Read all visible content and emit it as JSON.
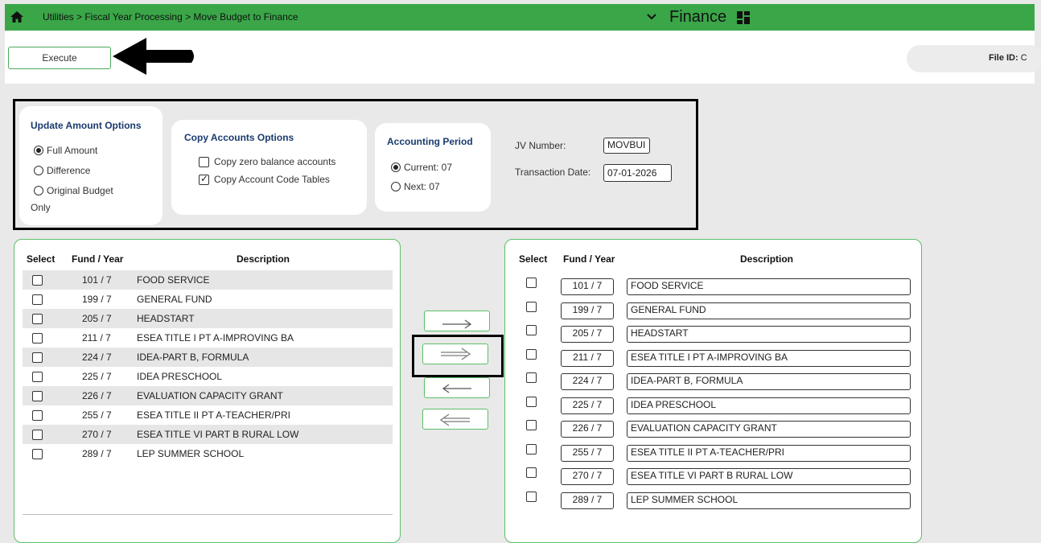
{
  "header": {
    "breadcrumb": "Utilities > Fiscal Year Processing > Move Budget to Finance",
    "app_title": "Finance",
    "bar_color": "#3aa648"
  },
  "toolbar": {
    "execute_label": "Execute",
    "file_id_label": "File ID:",
    "file_id_value": "C"
  },
  "update_amount": {
    "title": "Update Amount Options",
    "options": [
      {
        "label": "Full Amount",
        "selected": true
      },
      {
        "label": "Difference",
        "selected": false
      },
      {
        "label": "Original Budget",
        "selected": false
      }
    ],
    "wrap_text": "Only"
  },
  "copy_accounts": {
    "title": "Copy Accounts Options",
    "options": [
      {
        "label": "Copy zero balance accounts",
        "checked": false
      },
      {
        "label": "Copy Account Code Tables",
        "checked": true
      }
    ]
  },
  "accounting_period": {
    "title": "Accounting Period",
    "options": [
      {
        "label": "Current: 07",
        "selected": true
      },
      {
        "label": "Next: 07",
        "selected": false
      }
    ]
  },
  "jv": {
    "jv_label": "JV Number:",
    "jv_value": "MOVBUI",
    "date_label": "Transaction Date:",
    "date_value": "07-01-2026"
  },
  "left_table": {
    "headers": [
      "Select",
      "Fund / Year",
      "Description"
    ],
    "rows": [
      {
        "fund": "101 / 7",
        "desc": "FOOD SERVICE"
      },
      {
        "fund": "199 / 7",
        "desc": "GENERAL FUND"
      },
      {
        "fund": "205 / 7",
        "desc": "HEADSTART"
      },
      {
        "fund": "211 / 7",
        "desc": "ESEA TITLE I PT A-IMPROVING BA"
      },
      {
        "fund": "224 / 7",
        "desc": "IDEA-PART B, FORMULA"
      },
      {
        "fund": "225 / 7",
        "desc": "IDEA PRESCHOOL"
      },
      {
        "fund": "226 / 7",
        "desc": "EVALUATION CAPACITY GRANT"
      },
      {
        "fund": "255 / 7",
        "desc": "ESEA TITLE II PT A-TEACHER/PRI"
      },
      {
        "fund": "270 / 7",
        "desc": "ESEA TITLE VI PART B RURAL LOW"
      },
      {
        "fund": "289 / 7",
        "desc": "LEP SUMMER SCHOOL"
      }
    ]
  },
  "right_table": {
    "headers": [
      "Select",
      "Fund / Year",
      "Description"
    ],
    "rows": [
      {
        "fund": "101 / 7",
        "desc": "FOOD SERVICE"
      },
      {
        "fund": "199 / 7",
        "desc": "GENERAL FUND"
      },
      {
        "fund": "205 / 7",
        "desc": "HEADSTART"
      },
      {
        "fund": "211 / 7",
        "desc": "ESEA TITLE I PT A-IMPROVING BA"
      },
      {
        "fund": "224 / 7",
        "desc": "IDEA-PART B, FORMULA"
      },
      {
        "fund": "225 / 7",
        "desc": "IDEA PRESCHOOL"
      },
      {
        "fund": "226 / 7",
        "desc": "EVALUATION CAPACITY GRANT"
      },
      {
        "fund": "255 / 7",
        "desc": "ESEA TITLE II PT A-TEACHER/PRI"
      },
      {
        "fund": "270 / 7",
        "desc": "ESEA TITLE VI PART B RURAL LOW"
      },
      {
        "fund": "289 / 7",
        "desc": "LEP SUMMER SCHOOL"
      }
    ]
  },
  "move_buttons": [
    {
      "icon": "arrow-right-icon"
    },
    {
      "icon": "double-arrow-right-icon"
    },
    {
      "icon": "arrow-left-icon"
    },
    {
      "icon": "double-arrow-left-icon"
    }
  ]
}
